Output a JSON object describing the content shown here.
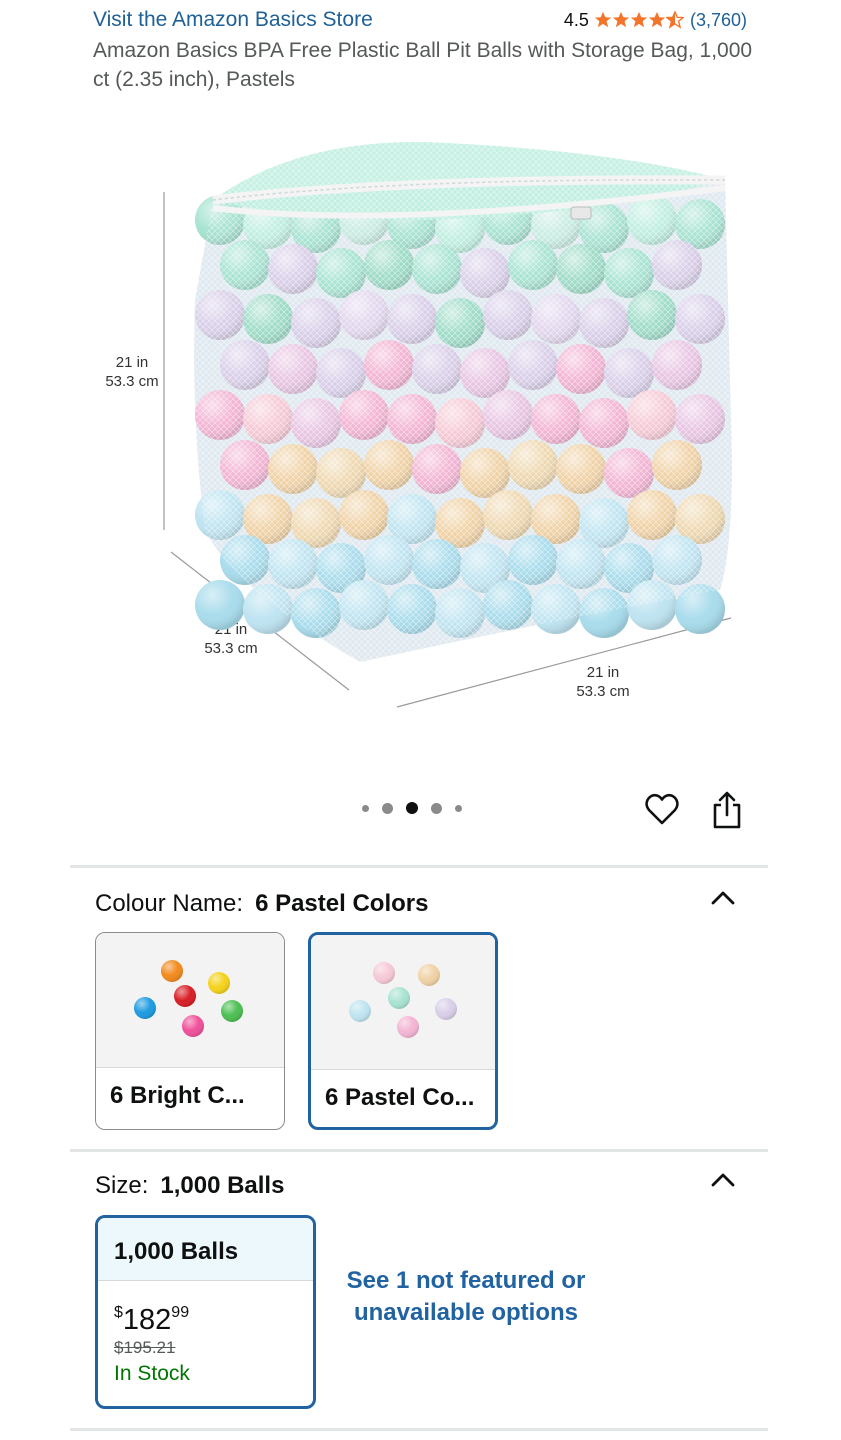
{
  "header": {
    "store_link": "Visit the Amazon Basics Store",
    "rating_value": "4.5",
    "rating_stars": 4.5,
    "rating_count": "(3,760)",
    "product_title": "Amazon Basics BPA Free Plastic Ball Pit Balls with Storage Bag, 1,000 ct (2.35 inch), Pastels"
  },
  "gallery": {
    "dimension_height": {
      "in": "21 in",
      "cm": "53.3 cm"
    },
    "dimension_depth": {
      "in": "21 in",
      "cm": "53.3 cm"
    },
    "dimension_width": {
      "in": "21 in",
      "cm": "53.3 cm"
    },
    "image_count": 5,
    "active_image": 3
  },
  "colour": {
    "key": "Colour Name:",
    "value": "6 Pastel Colors",
    "options": [
      {
        "label": "6 Bright C...",
        "selected": false
      },
      {
        "label": "6 Pastel Co...",
        "selected": true
      }
    ]
  },
  "size": {
    "key": "Size:",
    "value": "1,000 Balls",
    "option": {
      "label": "1,000 Balls",
      "currency": "$",
      "price_whole": "182",
      "price_cents": "99",
      "old_price": "$195.21",
      "stock": "In Stock"
    },
    "see_more": "See 1 not featured or unavailable options"
  },
  "colors": {
    "link": "#1f6196",
    "accent_blue": "#2162a1",
    "star": "#f3752b",
    "in_stock": "#007600"
  },
  "icons": [
    "star-icon",
    "heart-icon",
    "share-icon",
    "chevron-up-icon"
  ]
}
